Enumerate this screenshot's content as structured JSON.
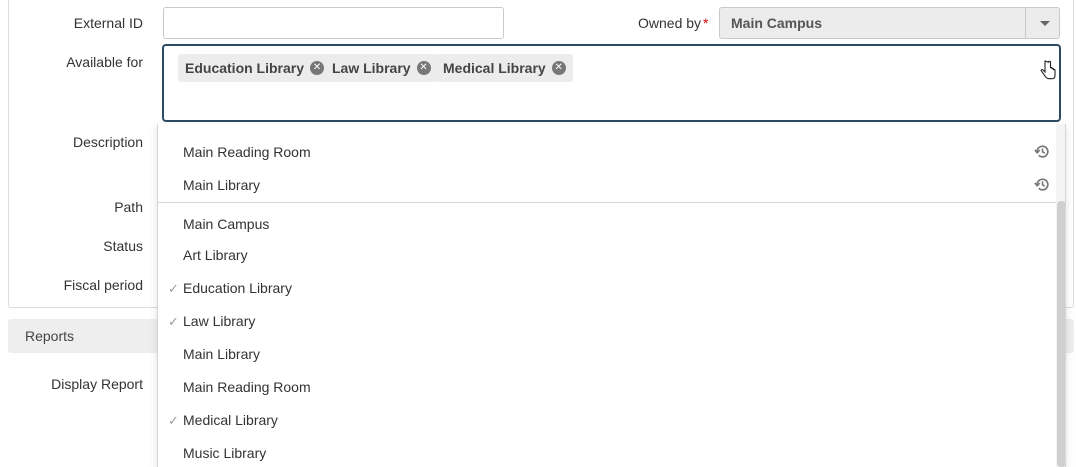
{
  "form": {
    "external_id_label": "External ID",
    "external_id_value": "",
    "owned_by_label": "Owned by",
    "owned_by_required": "*",
    "owned_by_value": "Main Campus",
    "available_for_label": "Available for",
    "description_label": "Description",
    "path_label": "Path",
    "status_label": "Status",
    "fiscal_period_label": "Fiscal period",
    "reports_section": "Reports",
    "display_report_label": "Display Report"
  },
  "available_for": {
    "chips": [
      {
        "label": "Education Library"
      },
      {
        "label": "Law Library"
      },
      {
        "label": "Medical Library"
      }
    ]
  },
  "dropdown": {
    "recent": [
      {
        "label": "Main Reading Room",
        "icon": "history-icon"
      },
      {
        "label": "Main Library",
        "icon": "history-icon"
      }
    ],
    "options": [
      {
        "label": "Main Campus",
        "checked": false
      },
      {
        "label": "Art Library",
        "checked": false
      },
      {
        "label": "Education Library",
        "checked": true
      },
      {
        "label": "Law Library",
        "checked": true
      },
      {
        "label": "Main Library",
        "checked": false
      },
      {
        "label": "Main Reading Room",
        "checked": false
      },
      {
        "label": "Medical Library",
        "checked": true
      },
      {
        "label": "Music Library",
        "checked": false
      }
    ],
    "check_glyph": "✓"
  },
  "colors": {
    "focus_border": "#2d4a63",
    "required": "#dd0000"
  }
}
